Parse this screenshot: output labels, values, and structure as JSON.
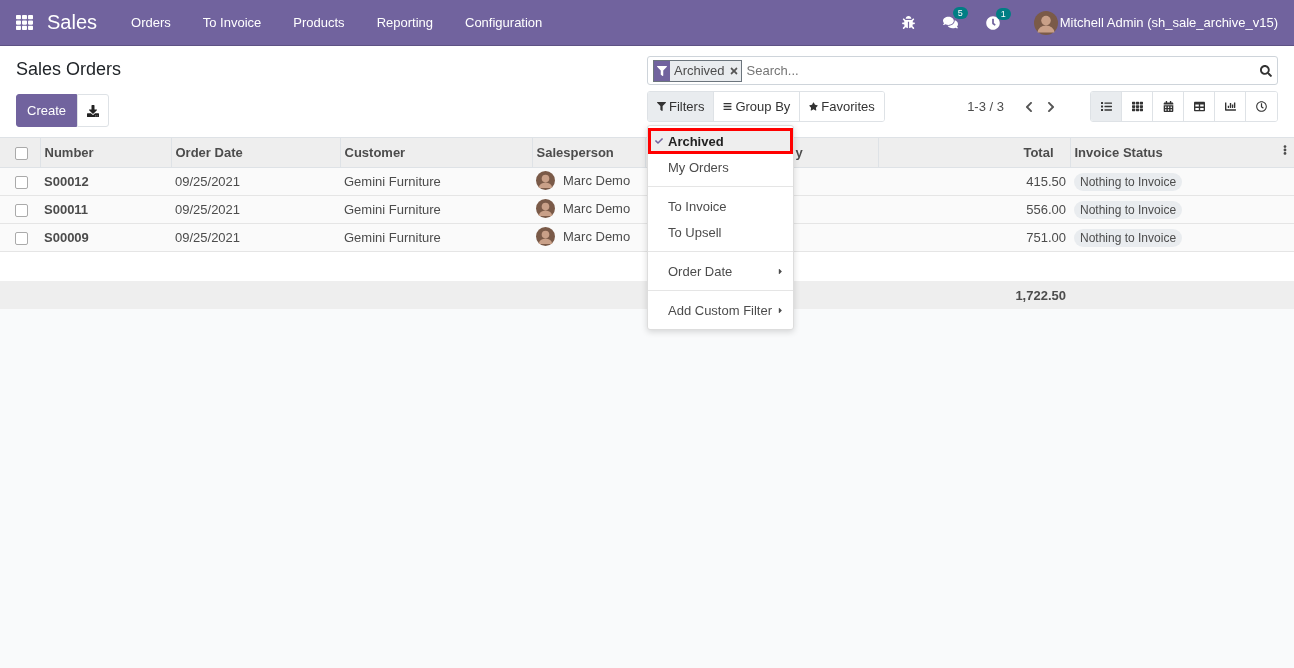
{
  "navbar": {
    "app": "Sales",
    "menu": [
      "Orders",
      "To Invoice",
      "Products",
      "Reporting",
      "Configuration"
    ],
    "messages_badge": "5",
    "activities_badge": "1",
    "user": "Mitchell Admin (sh_sale_archive_v15)"
  },
  "title": "Sales Orders",
  "create_button": "Create",
  "search": {
    "facets": [
      {
        "label": "Archived"
      }
    ],
    "placeholder": "Search..."
  },
  "search_buttons": [
    {
      "label": "Filters",
      "selected": true,
      "kind": "filter"
    },
    {
      "label": "Group By",
      "selected": false,
      "kind": "group"
    },
    {
      "label": "Favorites",
      "selected": false,
      "kind": "star"
    }
  ],
  "pager": "1-3 / 3",
  "views": [
    {
      "kind": "list",
      "selected": true
    },
    {
      "kind": "kanban",
      "selected": false
    },
    {
      "kind": "calendar",
      "selected": false
    },
    {
      "kind": "pivot",
      "selected": false
    },
    {
      "kind": "graph",
      "selected": false
    },
    {
      "kind": "activity",
      "selected": false
    }
  ],
  "table": {
    "select_all": false,
    "columns": [
      "Number",
      "Order Date",
      "Customer",
      "Salesperson",
      "y",
      "Total",
      "Invoice Status"
    ],
    "rows": [
      {
        "number": "S00012",
        "date": "09/25/2021",
        "customer": "Gemini Furniture",
        "salesperson": "Marc Demo",
        "total": "415.50",
        "status": "Nothing to Invoice",
        "checked": false
      },
      {
        "number": "S00011",
        "date": "09/25/2021",
        "customer": "Gemini Furniture",
        "salesperson": "Marc Demo",
        "total": "556.00",
        "status": "Nothing to Invoice",
        "checked": false
      },
      {
        "number": "S00009",
        "date": "09/25/2021",
        "customer": "Gemini Furniture",
        "salesperson": "Marc Demo",
        "total": "751.00",
        "status": "Nothing to Invoice",
        "checked": false
      }
    ],
    "sum": "1,722.50"
  },
  "filters_menu": [
    [
      {
        "label": "Archived",
        "checked": true,
        "highlighted": true,
        "submenu": false
      },
      {
        "label": "My Orders",
        "checked": false,
        "highlighted": false,
        "submenu": false
      }
    ],
    [
      {
        "label": "To Invoice",
        "checked": false,
        "highlighted": false,
        "submenu": false
      },
      {
        "label": "To Upsell",
        "checked": false,
        "highlighted": false,
        "submenu": false
      }
    ],
    [
      {
        "label": "Order Date",
        "checked": false,
        "highlighted": false,
        "submenu": true
      }
    ],
    [
      {
        "label": "Add Custom Filter",
        "checked": false,
        "highlighted": false,
        "submenu": true
      }
    ]
  ]
}
